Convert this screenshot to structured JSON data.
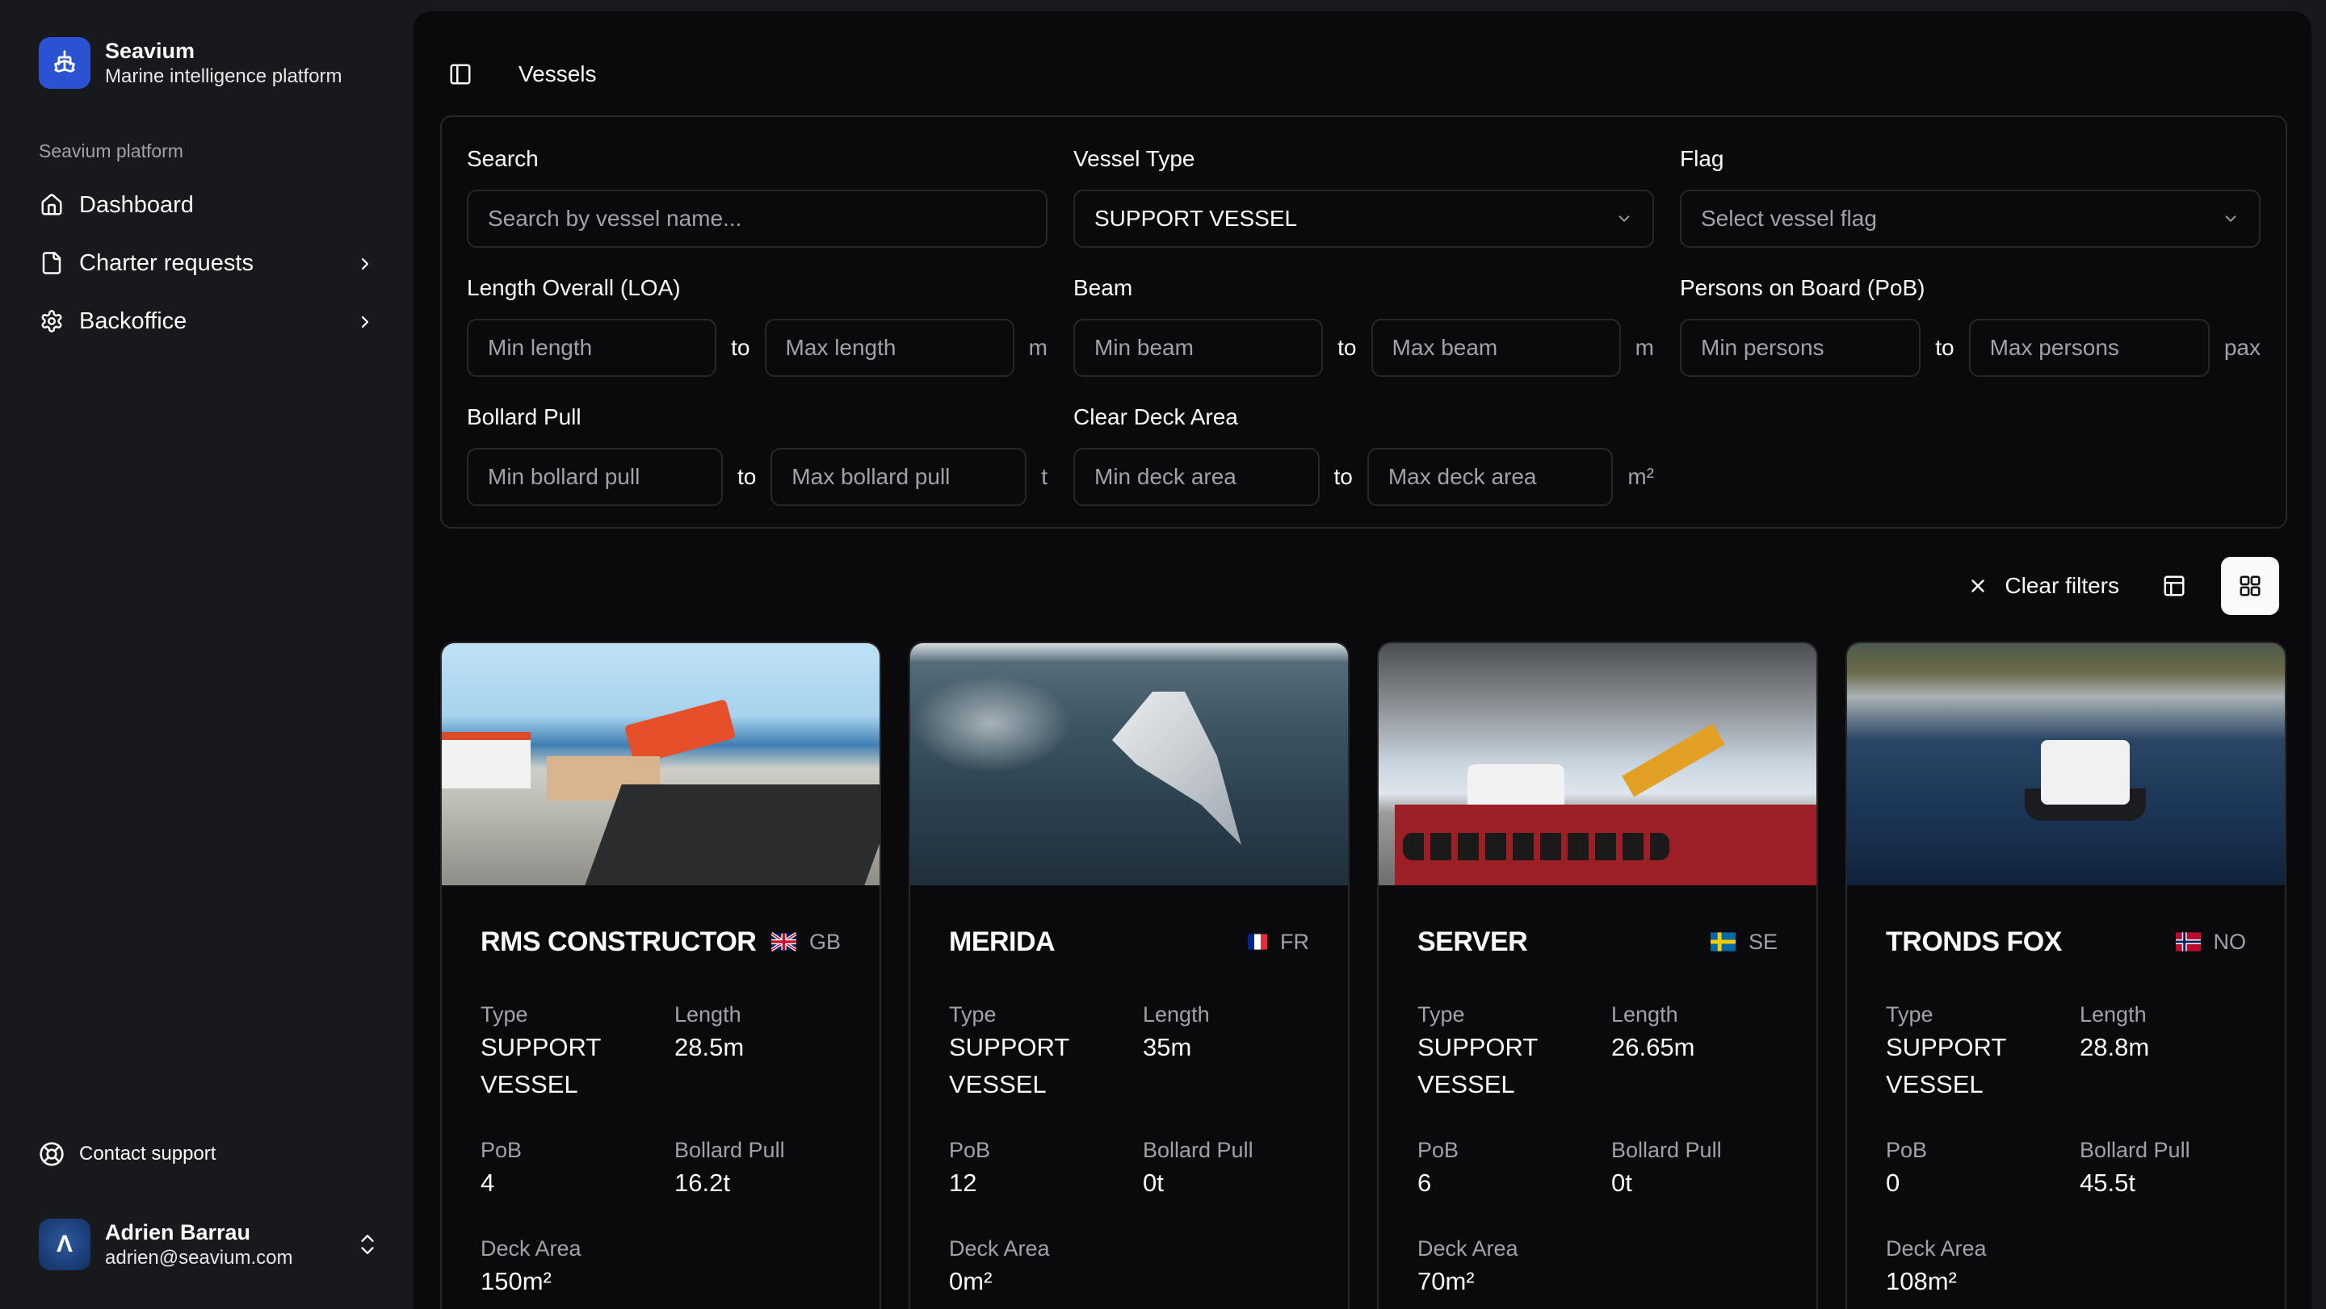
{
  "app": {
    "name": "Seavium",
    "subtitle": "Marine intelligence platform",
    "brand_color": "#2a52d3"
  },
  "sidebar": {
    "group_label": "Seavium platform",
    "items": [
      {
        "label": "Dashboard",
        "icon": "home-icon",
        "has_submenu": false
      },
      {
        "label": "Charter requests",
        "icon": "file-icon",
        "has_submenu": true
      },
      {
        "label": "Backoffice",
        "icon": "gear-icon",
        "has_submenu": true
      }
    ],
    "support_label": "Contact support",
    "user": {
      "name": "Adrien Barrau",
      "email": "adrien@seavium.com",
      "avatar_initial": "Λ"
    }
  },
  "header": {
    "title": "Vessels"
  },
  "filters": {
    "search": {
      "label": "Search",
      "placeholder": "Search by vessel name...",
      "value": ""
    },
    "vessel_type": {
      "label": "Vessel Type",
      "value": "SUPPORT VESSEL"
    },
    "flag": {
      "label": "Flag",
      "placeholder": "Select vessel flag",
      "value": ""
    },
    "loa": {
      "label": "Length Overall (LOA)",
      "min_placeholder": "Min length",
      "max_placeholder": "Max length",
      "unit": "m"
    },
    "beam": {
      "label": "Beam",
      "min_placeholder": "Min beam",
      "max_placeholder": "Max beam",
      "unit": "m"
    },
    "pob": {
      "label": "Persons on Board (PoB)",
      "min_placeholder": "Min persons",
      "max_placeholder": "Max persons",
      "unit": "pax"
    },
    "bollard": {
      "label": "Bollard Pull",
      "min_placeholder": "Min bollard pull",
      "max_placeholder": "Max bollard pull",
      "unit": "t"
    },
    "deck": {
      "label": "Clear Deck Area",
      "min_placeholder": "Min deck area",
      "max_placeholder": "Max deck area",
      "unit": "m²"
    },
    "range_separator": "to"
  },
  "toolbar": {
    "clear_label": "Clear filters",
    "view_mode": "grid",
    "views": [
      "table",
      "grid"
    ]
  },
  "field_labels": {
    "type": "Type",
    "length": "Length",
    "pob": "PoB",
    "bollard": "Bollard Pull",
    "deck": "Deck Area"
  },
  "vessels": [
    {
      "name": "RMS CONSTRUCTOR",
      "flag_code": "GB",
      "type": "SUPPORT VESSEL",
      "length": "28.5m",
      "pob": "4",
      "bollard": "16.2t",
      "deck": "150m²"
    },
    {
      "name": "MERIDA",
      "flag_code": "FR",
      "type": "SUPPORT VESSEL",
      "length": "35m",
      "pob": "12",
      "bollard": "0t",
      "deck": "0m²"
    },
    {
      "name": "SERVER",
      "flag_code": "SE",
      "type": "SUPPORT VESSEL",
      "length": "26.65m",
      "pob": "6",
      "bollard": "0t",
      "deck": "70m²"
    },
    {
      "name": "TRONDS FOX",
      "flag_code": "NO",
      "type": "SUPPORT VESSEL",
      "length": "28.8m",
      "pob": "0",
      "bollard": "45.5t",
      "deck": "108m²"
    }
  ]
}
